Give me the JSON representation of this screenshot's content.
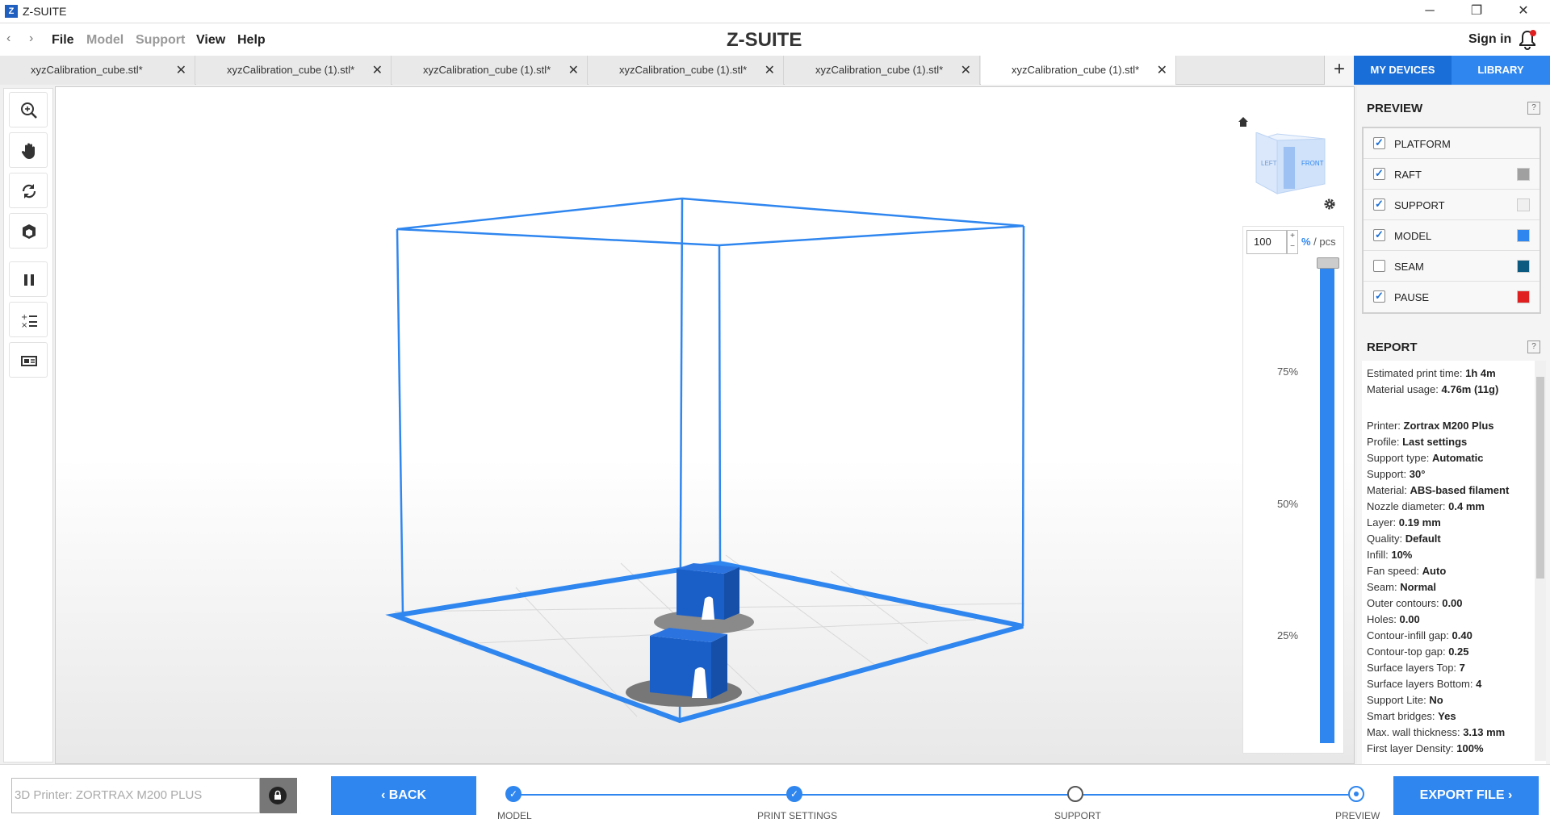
{
  "window": {
    "title": "Z-SUITE",
    "logo_letter": "Z",
    "controls": [
      "─",
      "❐",
      "✕"
    ]
  },
  "menubar": {
    "items": [
      "File",
      "Model",
      "Support",
      "View",
      "Help"
    ],
    "brand": "Z-SUITE",
    "signin": "Sign in"
  },
  "tabs": [
    {
      "label": "xyzCalibration_cube.stl*",
      "active": false
    },
    {
      "label": "xyzCalibration_cube (1).stl*",
      "active": false
    },
    {
      "label": "xyzCalibration_cube (1).stl*",
      "active": false
    },
    {
      "label": "xyzCalibration_cube (1).stl*",
      "active": false
    },
    {
      "label": "xyzCalibration_cube (1).stl*",
      "active": false
    },
    {
      "label": "xyzCalibration_cube (1).stl*",
      "active": true
    }
  ],
  "tab_close": "✕",
  "add_tab": "+",
  "header_buttons": {
    "my_devices": "MY DEVICES",
    "library": "LIBRARY"
  },
  "toolbar_icons": [
    "zoom-icon",
    "hand-pan-icon",
    "rotate-icon",
    "view-cube-icon",
    "pause-icon",
    "layer-settings-icon",
    "layers-icon"
  ],
  "view_cube": {
    "left": "LEFT",
    "front": "FRONT"
  },
  "layer_slider": {
    "value": "100",
    "unit_pct": "%",
    "unit_rest": " / pcs",
    "step_up": "+",
    "step_down": "−",
    "ticks": [
      "75%",
      "50%",
      "25%"
    ],
    "level_fraction": 1.0
  },
  "preview": {
    "title": "PREVIEW",
    "help": "?",
    "rows": [
      {
        "label": "PLATFORM",
        "checked": true,
        "color": ""
      },
      {
        "label": "RAFT",
        "checked": true,
        "color": "#a0a0a0"
      },
      {
        "label": "SUPPORT",
        "checked": true,
        "color": "#f0f0f0"
      },
      {
        "label": "MODEL",
        "checked": true,
        "color": "#2f86ef"
      },
      {
        "label": "SEAM",
        "checked": false,
        "color": "#0d5a80"
      },
      {
        "label": "PAUSE",
        "checked": true,
        "color": "#e02020"
      }
    ]
  },
  "report": {
    "title": "REPORT",
    "help": "?",
    "lines": [
      {
        "k": "Estimated print time: ",
        "v": "1h 4m"
      },
      {
        "k": "Material usage: ",
        "v": "4.76m (11g)"
      },
      {
        "k": "",
        "v": ""
      },
      {
        "k": "Printer: ",
        "v": "Zortrax M200 Plus"
      },
      {
        "k": "Profile: ",
        "v": "Last settings"
      },
      {
        "k": "Support type: ",
        "v": "Automatic"
      },
      {
        "k": "Support: ",
        "v": "30°"
      },
      {
        "k": "Material: ",
        "v": "ABS-based filament"
      },
      {
        "k": "Nozzle diameter: ",
        "v": "0.4 mm"
      },
      {
        "k": "Layer: ",
        "v": "0.19 mm"
      },
      {
        "k": "Quality: ",
        "v": "Default"
      },
      {
        "k": "Infill: ",
        "v": "10%"
      },
      {
        "k": "Fan speed: ",
        "v": "Auto"
      },
      {
        "k": "Seam: ",
        "v": "Normal"
      },
      {
        "k": "Outer contours: ",
        "v": "0.00"
      },
      {
        "k": "Holes: ",
        "v": "0.00"
      },
      {
        "k": "Contour-infill gap: ",
        "v": "0.40"
      },
      {
        "k": "Contour-top gap: ",
        "v": "0.25"
      },
      {
        "k": "Surface layers Top: ",
        "v": "7"
      },
      {
        "k": "Surface layers Bottom: ",
        "v": "4"
      },
      {
        "k": "Support Lite: ",
        "v": "No"
      },
      {
        "k": "Smart bridges: ",
        "v": "Yes"
      },
      {
        "k": "Max. wall thickness: ",
        "v": "3.13 mm"
      },
      {
        "k": "First layer Density: ",
        "v": "100%"
      }
    ]
  },
  "bottom": {
    "printer_placeholder": "3D Printer: ZORTRAX M200 PLUS",
    "back": "BACK",
    "back_arrow": "‹",
    "export": "EXPORT FILE",
    "export_arrow": "›",
    "steps": [
      {
        "label": "MODEL",
        "state": "done"
      },
      {
        "label": "PRINT SETTINGS",
        "state": "done"
      },
      {
        "label": "SUPPORT",
        "state": "locked"
      },
      {
        "label": "PREVIEW",
        "state": "current"
      }
    ]
  },
  "colors": {
    "accent": "#2f86ef",
    "accent_dark": "#1a6ed8",
    "model": "#1f5fbf"
  }
}
